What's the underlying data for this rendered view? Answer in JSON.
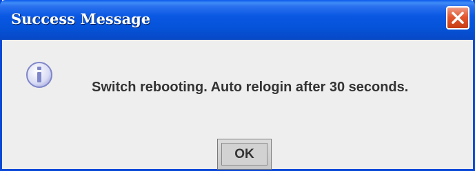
{
  "window": {
    "title": "Success Message",
    "close_icon": "close-icon"
  },
  "content": {
    "icon": "info-icon",
    "message": "Switch rebooting. Auto relogin after 30 seconds."
  },
  "actions": {
    "ok_label": "OK"
  },
  "colors": {
    "titlebar": "#0a58e3",
    "close_button": "#e2572f",
    "background": "#eeeeee",
    "icon": "#8a8fd0"
  }
}
